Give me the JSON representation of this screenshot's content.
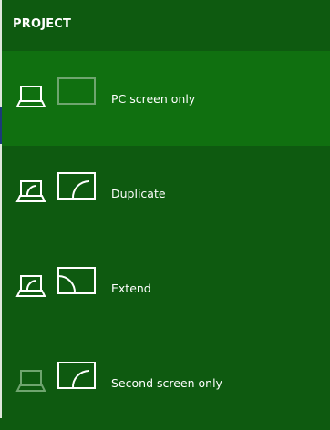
{
  "panel": {
    "title": "PROJECT",
    "options": [
      {
        "label": "PC screen only",
        "selected": true
      },
      {
        "label": "Duplicate",
        "selected": false
      },
      {
        "label": "Extend",
        "selected": false
      },
      {
        "label": "Second screen only",
        "selected": false
      }
    ]
  },
  "colors": {
    "panel_bg": "#0e5a10",
    "selected_bg": "#107010",
    "icon_active": "#ffffff",
    "icon_inactive": "#6fa56f"
  }
}
